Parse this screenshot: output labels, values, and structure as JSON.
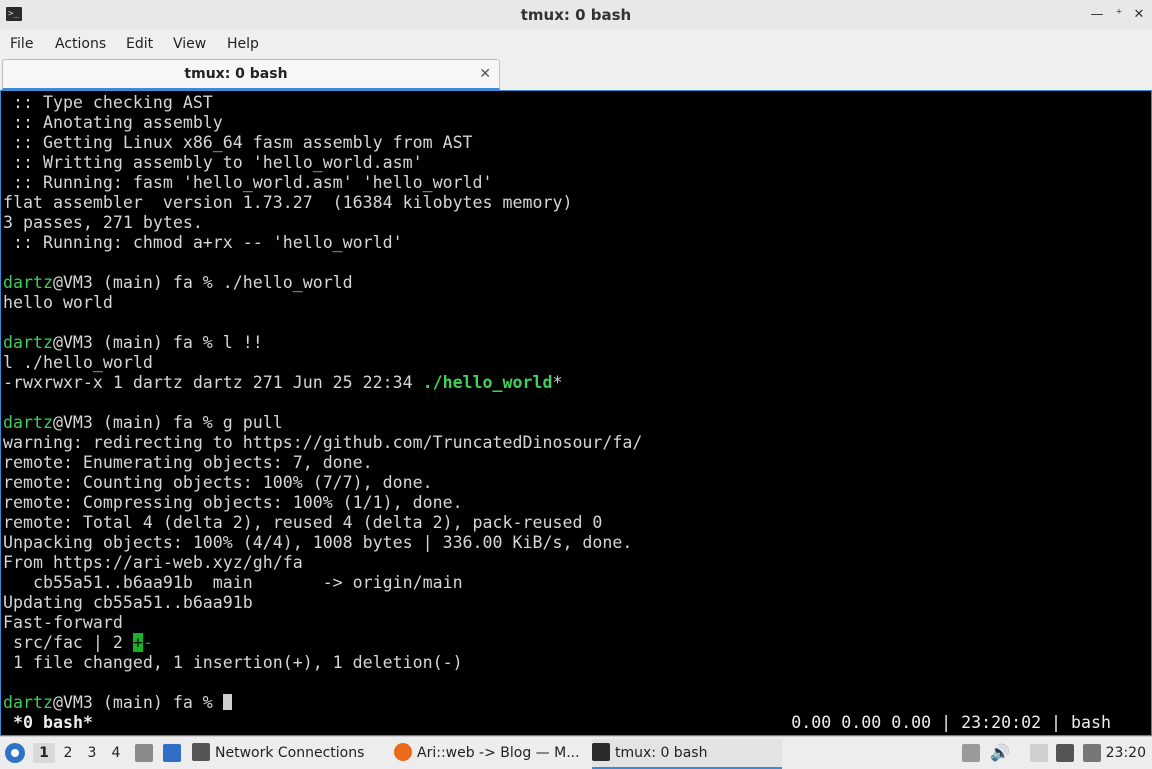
{
  "window": {
    "title": "tmux: 0 bash",
    "icon": "terminal-icon",
    "controls": {
      "minimize": "—",
      "maximize": "⁺",
      "close": "✕"
    }
  },
  "menu": [
    "File",
    "Actions",
    "Edit",
    "View",
    "Help"
  ],
  "tab": {
    "label": "tmux: 0 bash",
    "close": "✕"
  },
  "terminal": {
    "lines": [
      " :: Type checking AST",
      " :: Anotating assembly",
      " :: Getting Linux x86_64 fasm assembly from AST",
      " :: Writting assembly to 'hello_world.asm'",
      " :: Running: fasm 'hello_world.asm' 'hello_world'",
      "flat assembler  version 1.73.27  (16384 kilobytes memory)",
      "3 passes, 271 bytes.",
      " :: Running: chmod a+rx -- 'hello_world'",
      "",
      "@VM3 (main) fa % ./hello_world",
      "hello world",
      "",
      "@VM3 (main) fa % l !!",
      "l ./hello_world",
      "-rwxrwxr-x 1 dartz dartz 271 Jun 25 22:34 ",
      "",
      "@VM3 (main) fa % g pull",
      "warning: redirecting to https://github.com/TruncatedDinosour/fa/",
      "remote: Enumerating objects: 7, done.",
      "remote: Counting objects: 100% (7/7), done.",
      "remote: Compressing objects: 100% (1/1), done.",
      "remote: Total 4 (delta 2), reused 4 (delta 2), pack-reused 0",
      "Unpacking objects: 100% (4/4), 1008 bytes | 336.00 KiB/s, done.",
      "From https://ari-web.xyz/gh/fa",
      "   cb55a51..b6aa91b  main       -> origin/main",
      "Updating cb55a51..b6aa91b",
      "Fast-forward",
      " src/fac | 2 ",
      " 1 file changed, 1 insertion(+), 1 deletion(-)",
      "",
      "@VM3 (main) fa % "
    ],
    "prompt_user": "dartz",
    "ls_file": "./hello_world",
    "ls_suffix": "*",
    "diff_plus": "+",
    "diff_minus": "-",
    "status_left": "*0 bash*",
    "status_right": "0.00 0.00 0.00 | 23:20:02 | bash"
  },
  "taskbar": {
    "workspaces": [
      "1",
      "2",
      "3",
      "4"
    ],
    "active_workspace": "1",
    "tasks": [
      {
        "label": "Network Connections",
        "icon": "network-icon"
      },
      {
        "label": "Ari::web -> Blog — M...",
        "icon": "firefox-icon"
      },
      {
        "label": "tmux: 0 bash",
        "icon": "terminal-icon"
      }
    ],
    "clock": "23:20"
  }
}
